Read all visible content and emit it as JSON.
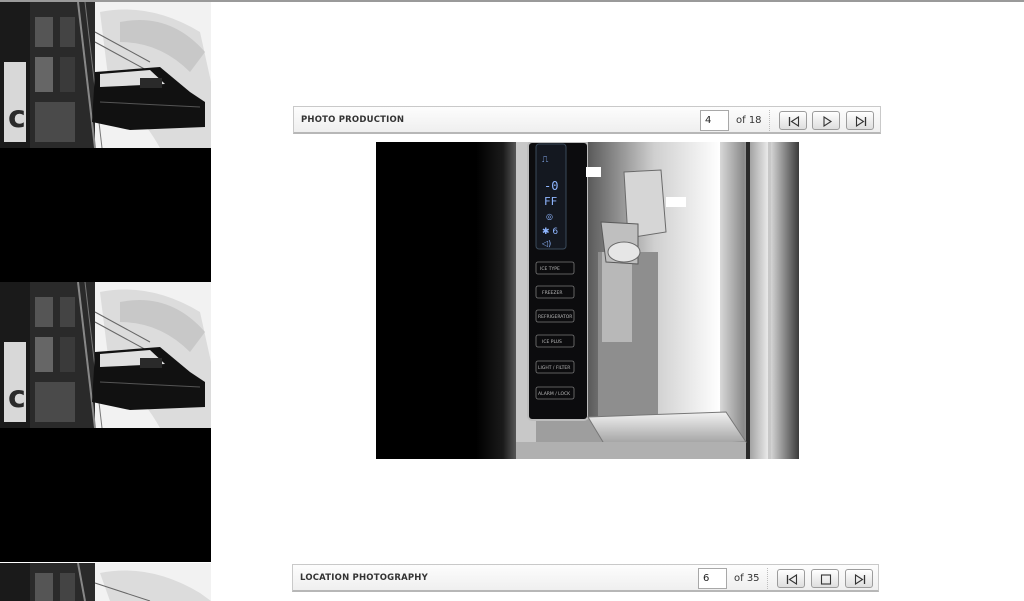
{
  "galleries": [
    {
      "title": "PHOTO PRODUCTION",
      "page_value": "4",
      "page_total": "of 18",
      "controls": [
        "first-icon",
        "play-icon",
        "last-icon"
      ]
    },
    {
      "title": "LOCATION PHOTOGRAPHY",
      "page_value": "6",
      "page_total": "of 35",
      "controls": [
        "first-icon",
        "stop-icon",
        "last-icon"
      ]
    }
  ],
  "photo": {
    "subject": "refrigerator-dispenser",
    "panel_buttons": [
      "ICE TYPE",
      "FREEZER",
      "REFRIGERATOR",
      "ICE PLUS",
      "LIGHT / FILTER",
      "ALARM / LOCK"
    ]
  },
  "colors": {
    "toolbar_border": "#c9c9c9",
    "toolbar_text": "#333333",
    "photo_background": "#000000"
  }
}
